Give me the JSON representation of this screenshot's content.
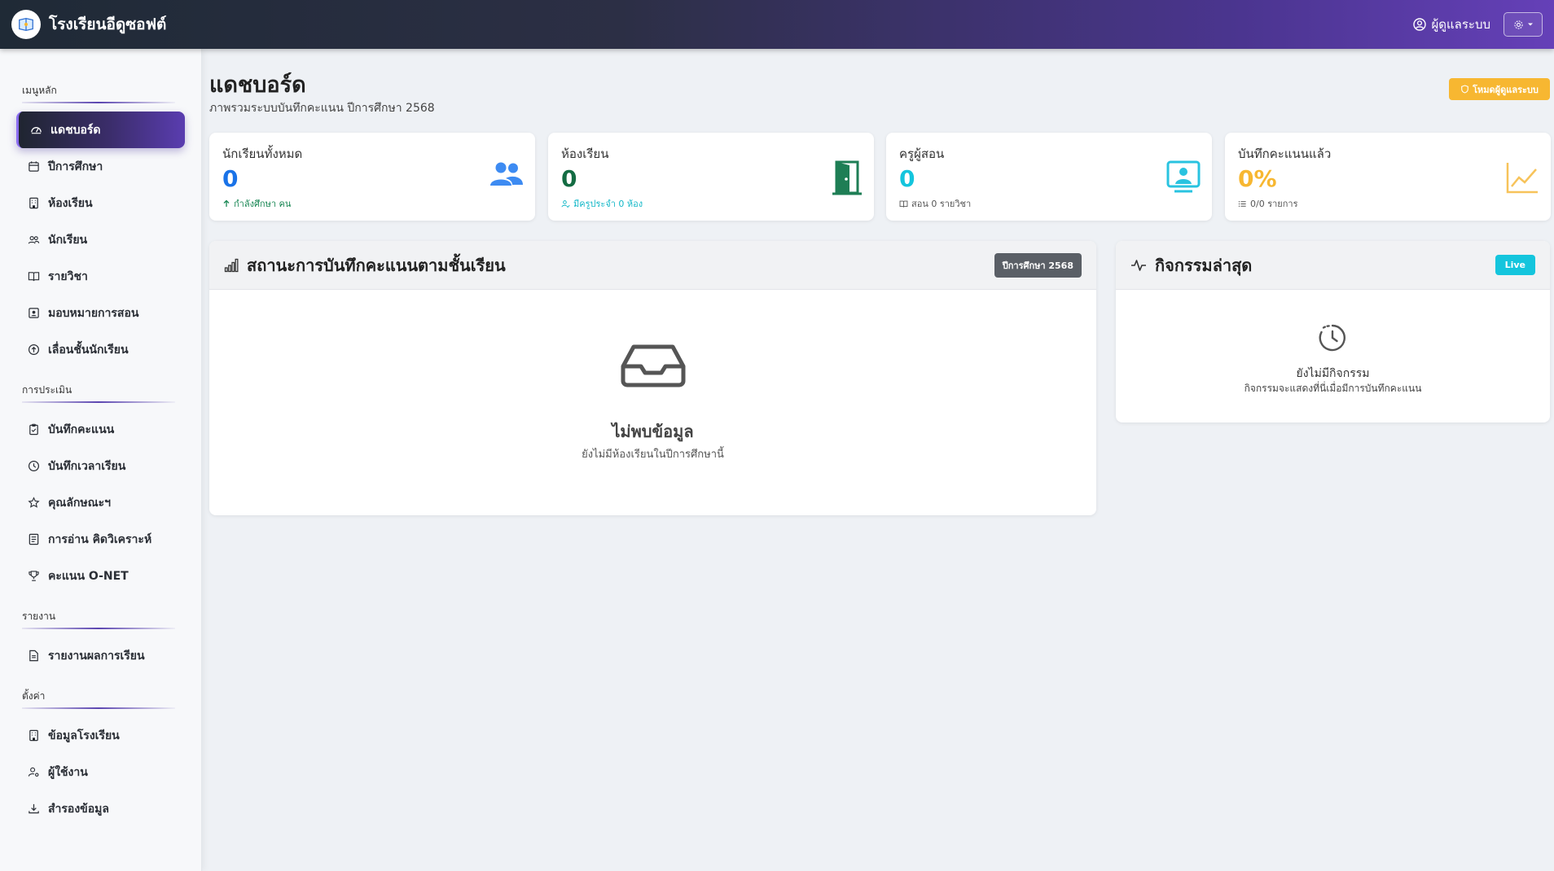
{
  "app": {
    "name": "โรงเรียนอีดูซอฟต์"
  },
  "topbar": {
    "user_label": "ผู้ดูแลระบบ"
  },
  "sidebar": {
    "sections": [
      {
        "title": "เมนูหลัก",
        "items": [
          {
            "label": "แดชบอร์ด",
            "icon": "dashboard-icon",
            "active": true
          },
          {
            "label": "ปีการศึกษา",
            "icon": "calendar-icon"
          },
          {
            "label": "ห้องเรียน",
            "icon": "building-icon"
          },
          {
            "label": "นักเรียน",
            "icon": "people-icon"
          },
          {
            "label": "รายวิชา",
            "icon": "book-icon"
          },
          {
            "label": "มอบหมายการสอน",
            "icon": "teacher-icon"
          },
          {
            "label": "เลื่อนชั้นนักเรียน",
            "icon": "arrow-up-circle-icon"
          }
        ]
      },
      {
        "title": "การประเมิน",
        "items": [
          {
            "label": "บันทึกคะแนน",
            "icon": "clipboard-icon"
          },
          {
            "label": "บันทึกเวลาเรียน",
            "icon": "clock-icon"
          },
          {
            "label": "คุณลักษณะฯ",
            "icon": "star-icon"
          },
          {
            "label": "การอ่าน คิดวิเคราะห์",
            "icon": "document-icon"
          },
          {
            "label": "คะแนน O-NET",
            "icon": "trophy-icon"
          }
        ]
      },
      {
        "title": "รายงาน",
        "items": [
          {
            "label": "รายงานผลการเรียน",
            "icon": "report-icon"
          }
        ]
      },
      {
        "title": "ตั้งค่า",
        "items": [
          {
            "label": "ข้อมูลโรงเรียน",
            "icon": "building-icon"
          },
          {
            "label": "ผู้ใช้งาน",
            "icon": "user-gear-icon"
          },
          {
            "label": "สำรองข้อมูล",
            "icon": "download-icon"
          }
        ]
      }
    ]
  },
  "header": {
    "title": "แดชบอร์ด",
    "subtitle": "ภาพรวมระบบบันทึกคะแนน ปีการศึกษา 2568",
    "admin_badge": "โหมดผู้ดูแลระบบ"
  },
  "stats": [
    {
      "label": "นักเรียนทั้งหมด",
      "value": "0",
      "sub": "กำลังศึกษา คน",
      "color": "#1a73e8",
      "sub_color": "#198754",
      "icon": "users-icon"
    },
    {
      "label": "ห้องเรียน",
      "value": "0",
      "sub": "มีครูประจำ 0 ห้อง",
      "color": "#146c43",
      "sub_color": "#14b8c8",
      "icon": "door-icon"
    },
    {
      "label": "ครูผู้สอน",
      "value": "0",
      "sub": "สอน 0 รายวิชา",
      "color": "#14c5dd",
      "sub_color": "#555555",
      "icon": "teacher-board-icon"
    },
    {
      "label": "บันทึกคะแนนแล้ว",
      "value": "0%",
      "sub": "0/0 รายการ",
      "color": "#f7b731",
      "sub_color": "#555555",
      "icon": "line-chart-icon"
    }
  ],
  "status_panel": {
    "title": "สถานะการบันทึกคะแนนตามชั้นเรียน",
    "badge": "ปีการศึกษา 2568",
    "empty_title": "ไม่พบข้อมูล",
    "empty_text": "ยังไม่มีห้องเรียนในปีการศึกษานี้"
  },
  "activity_panel": {
    "title": "กิจกรรมล่าสุด",
    "badge": "Live",
    "empty_title": "ยังไม่มีกิจกรรม",
    "empty_text": "กิจกรรมจะแสดงที่นี่เมื่อมีการบันทึกคะแนน"
  }
}
